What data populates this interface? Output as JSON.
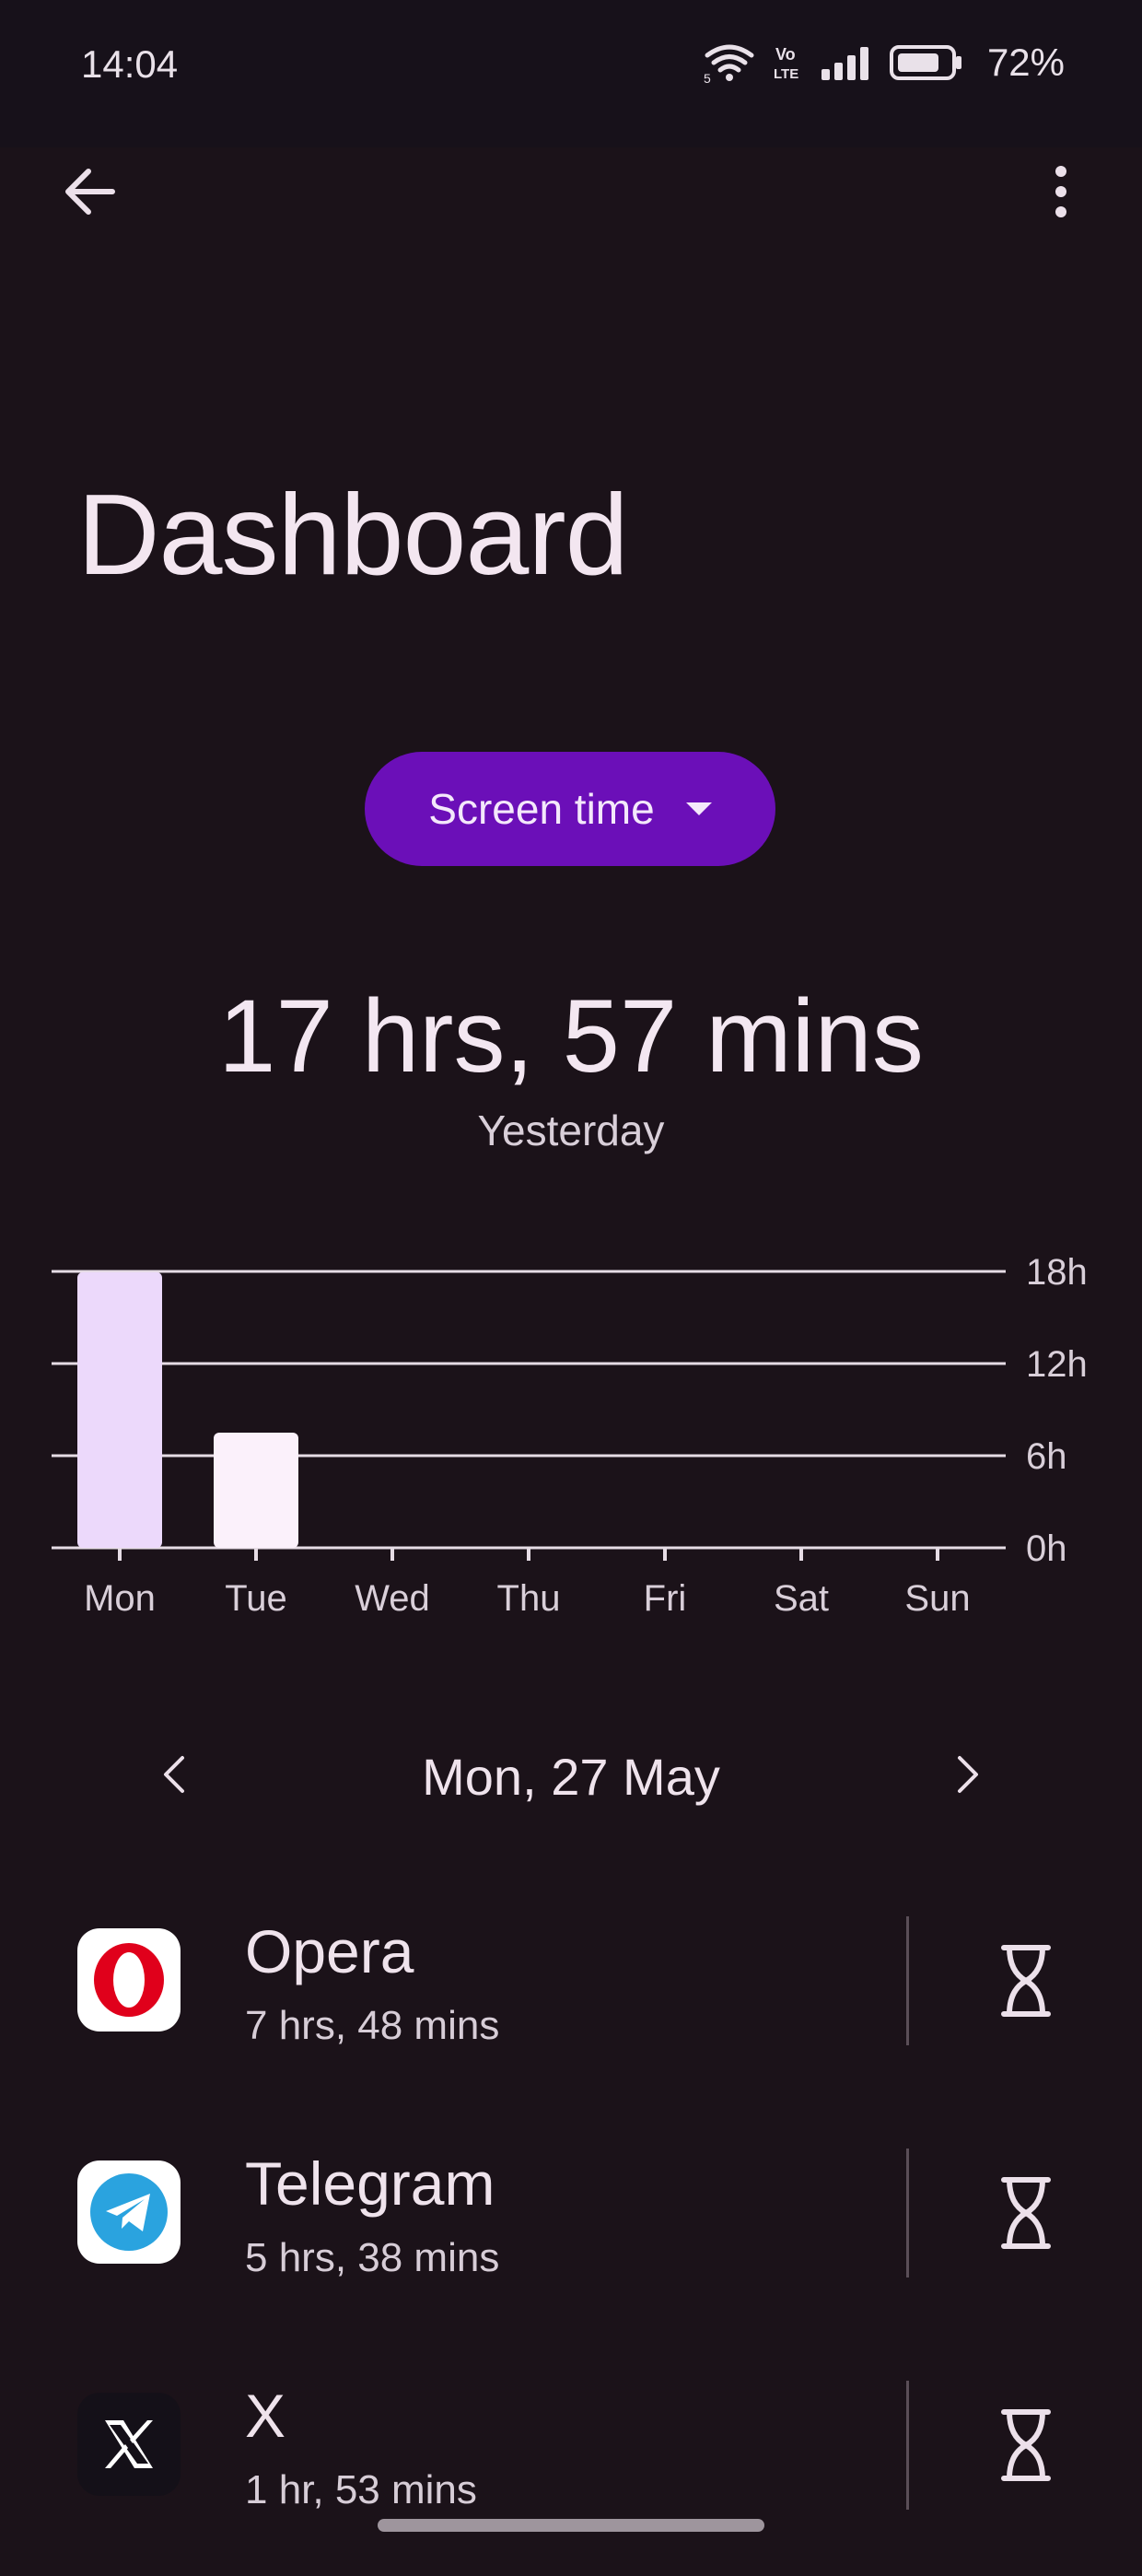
{
  "status_bar": {
    "time": "14:04",
    "battery_percent": "72%",
    "network_label_top": "Vo",
    "network_label_bottom": "LTE",
    "wifi_sub": "5"
  },
  "page": {
    "title": "Dashboard"
  },
  "metric_selector": {
    "label": "Screen time"
  },
  "summary": {
    "total": "17 hrs, 57 mins",
    "period": "Yesterday"
  },
  "chart_data": {
    "type": "bar",
    "categories": [
      "Mon",
      "Tue",
      "Wed",
      "Thu",
      "Fri",
      "Sat",
      "Sun"
    ],
    "values": [
      17.95,
      7.5,
      0,
      0,
      0,
      0,
      0
    ],
    "y_ticks": [
      "0h",
      "6h",
      "12h",
      "18h"
    ],
    "ylim": [
      0,
      18
    ],
    "selected_index": 0,
    "colors": {
      "selected": "#ecd9fb",
      "other": "#fbf1fb",
      "grid": "#e6dce5"
    }
  },
  "date_nav": {
    "label": "Mon, 27 May"
  },
  "apps": [
    {
      "name": "Opera",
      "usage": "7 hrs, 48 mins",
      "icon": "opera-icon"
    },
    {
      "name": "Telegram",
      "usage": "5 hrs, 38 mins",
      "icon": "telegram-icon"
    },
    {
      "name": "X",
      "usage": "1 hr, 53 mins",
      "icon": "x-icon"
    }
  ],
  "colors": {
    "background": "#1b1219",
    "accent": "#6b0fb8"
  }
}
